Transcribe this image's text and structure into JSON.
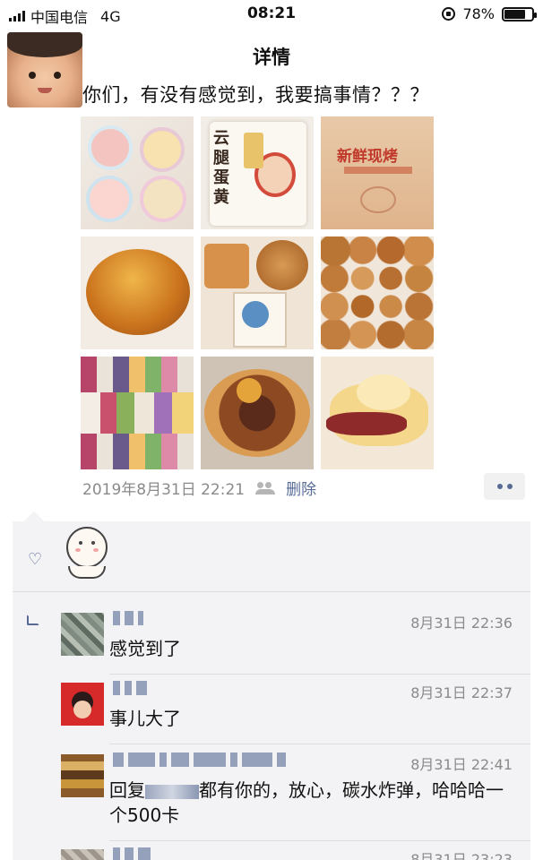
{
  "status_bar": {
    "carrier": "中国电信",
    "network": "4G",
    "time": "08:21",
    "battery": "78%",
    "battery_level": 0.78
  },
  "nav": {
    "title": "详情"
  },
  "post": {
    "text": "你们，有没有感觉到，我要搞事情？？？",
    "photos": [
      {
        "label": ""
      },
      {
        "label": "云腿蛋黄"
      },
      {
        "label": "新鲜现烤"
      },
      {
        "label": ""
      },
      {
        "label": ""
      },
      {
        "label": ""
      },
      {
        "label": ""
      },
      {
        "label": ""
      },
      {
        "label": ""
      }
    ],
    "timestamp": "2019年8月31日 22:21",
    "delete_label": "删除"
  },
  "comments": [
    {
      "time": "8月31日 22:36",
      "text": "感觉到了"
    },
    {
      "time": "8月31日 22:37",
      "text": "事儿大了"
    },
    {
      "time": "8月31日 22:41",
      "reply_prefix": "回复",
      "text": "都有你的，放心，碳水炸弹，哈哈哈一个500卡"
    },
    {
      "time": "8月31日 23:23",
      "text": ""
    }
  ],
  "colors": {
    "link": "#576b95",
    "meta": "#8a8a8a",
    "comment_bg": "#f3f3f5"
  }
}
